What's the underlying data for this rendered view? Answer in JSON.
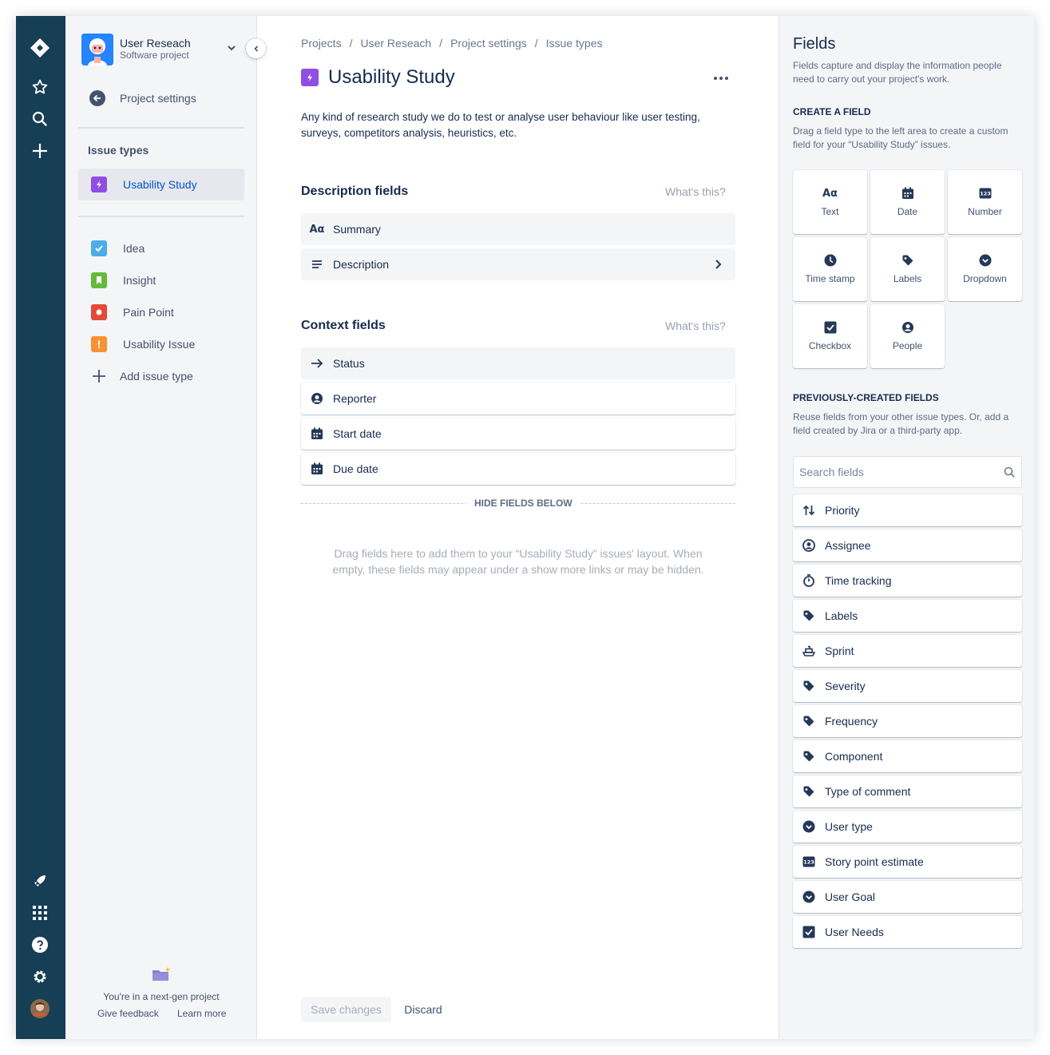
{
  "global_nav": {
    "icons": [
      "jira-logo-icon",
      "star-icon",
      "search-icon",
      "create-icon",
      "rocket-icon",
      "app-switcher-icon",
      "help-icon",
      "settings-icon",
      "profile-avatar"
    ]
  },
  "sidebar": {
    "project_name": "User Reseach",
    "project_type": "Software project",
    "back_label": "Project settings",
    "issue_types_heading": "Issue types",
    "selected_type": "Usability Study",
    "types": [
      {
        "label": "Idea",
        "color": "#4bade8"
      },
      {
        "label": "Insight",
        "color": "#63ba3c"
      },
      {
        "label": "Pain Point",
        "color": "#e5493a"
      },
      {
        "label": "Usability Issue",
        "color": "#f79232"
      }
    ],
    "add_label": "Add issue type",
    "footer": {
      "text": "You're in a next-gen project",
      "give_feedback": "Give feedback",
      "learn_more": "Learn more"
    }
  },
  "main": {
    "breadcrumbs": [
      "Projects",
      "User Reseach",
      "Project settings",
      "Issue types"
    ],
    "title": "Usability Study",
    "description": "Any kind of research study we do to test or analyse user behaviour like user testing, surveys, competitors analysis, heuristics, etc.",
    "description_section": {
      "title": "Description fields",
      "help": "What's this?",
      "fields": [
        "Summary",
        "Description"
      ]
    },
    "context_section": {
      "title": "Context fields",
      "help": "What's this?",
      "fields": [
        "Status",
        "Reporter",
        "Start date",
        "Due date"
      ]
    },
    "hide_fields_label": "HIDE FIELDS BELOW",
    "drop_hint": "Drag fields here to add them to your “Usability Study” issues' layout. When empty, these fields may appear under a show more links or may be hidden.",
    "save_label": "Save changes",
    "discard_label": "Discard"
  },
  "fields_panel": {
    "title": "Fields",
    "subtitle": "Fields capture and display the information people need to carry out your project's work.",
    "create_heading": "CREATE A FIELD",
    "create_sub": "Drag a field type to the left area to create a custom field for your “Usability Study” issues.",
    "field_types": [
      "Text",
      "Date",
      "Number",
      "Time stamp",
      "Labels",
      "Dropdown",
      "Checkbox",
      "People"
    ],
    "prev_heading": "PREVIOUSLY-CREATED FIELDS",
    "prev_sub": "Reuse fields from your other issue types. Or, add a field created by Jira or a third-party app.",
    "search_placeholder": "Search fields",
    "previous_fields": [
      "Priority",
      "Assignee",
      "Time tracking",
      "Labels",
      "Sprint",
      "Severity",
      "Frequency",
      "Component",
      "Type of comment",
      "User type",
      "Story point estimate",
      "User Goal",
      "User Needs"
    ]
  }
}
